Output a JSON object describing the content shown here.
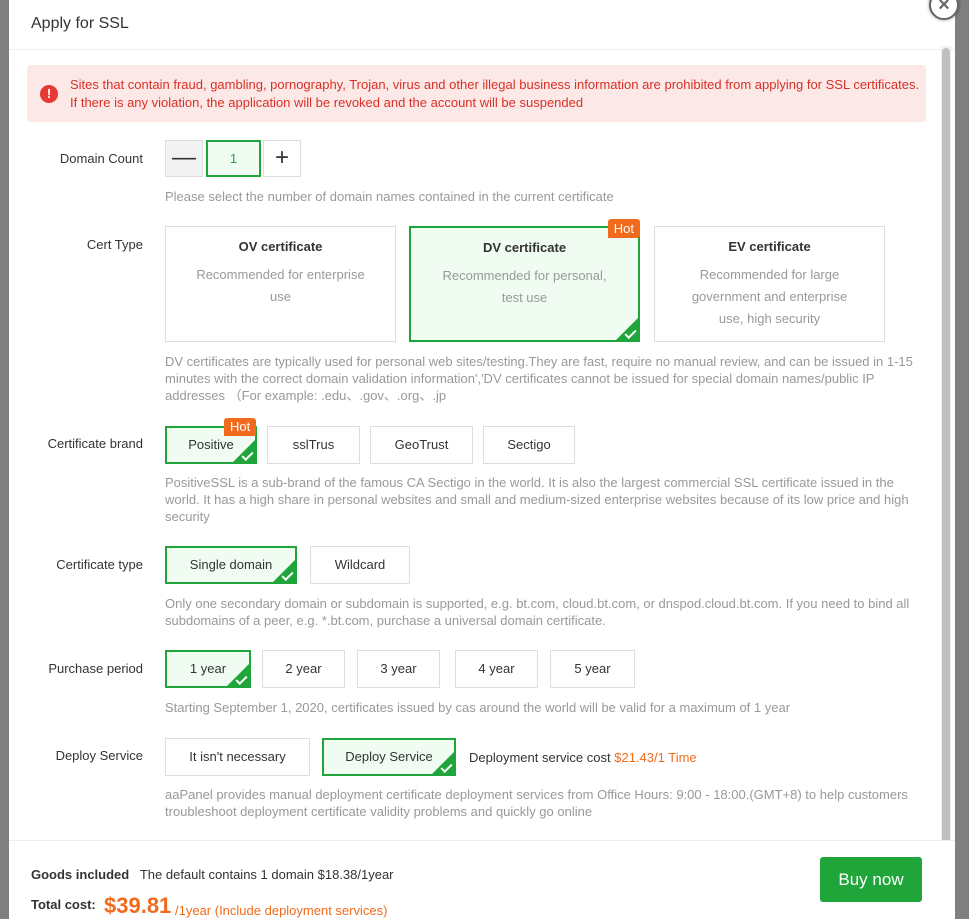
{
  "modal": {
    "title": "Apply for SSL",
    "close_glyph": "×"
  },
  "warning": {
    "icon": "!",
    "text": "Sites that contain fraud, gambling, pornography, Trojan, virus and other illegal business information are prohibited from applying for SSL certificates. If there is any violation, the application will be revoked and the account will be suspended"
  },
  "domain_count": {
    "label": "Domain Count",
    "minus": "—",
    "plus": "+",
    "value": "1",
    "hint": "Please select the number of domain names contained in the current certificate"
  },
  "cert_type": {
    "label": "Cert Type",
    "cards": [
      {
        "title": "OV certificate",
        "desc": "Recommended for enterprise use"
      },
      {
        "title": "DV certificate",
        "desc": "Recommended for personal, test use",
        "badge": "Hot"
      },
      {
        "title": "EV certificate",
        "desc": "Recommended for large government and enterprise use, high security"
      }
    ],
    "selected": "DV certificate",
    "hint": "DV certificates are typically used for personal web sites/testing.They are fast, require no manual review, and can be issued in 1-15 minutes with the correct domain validation information','DV certificates cannot be issued for special domain names/public IP addresses （For example: .edu、.gov、.org、.jp"
  },
  "brand": {
    "label": "Certificate brand",
    "options": [
      "Positive",
      "sslTrus",
      "GeoTrust",
      "Sectigo"
    ],
    "badge": "Hot",
    "selected": "Positive",
    "hint": "PositiveSSL is a sub-brand of the famous CA Sectigo in the world. It is also the largest commercial SSL certificate issued in the world. It has a high share in personal websites and small and medium-sized enterprise websites because of its low price and high security"
  },
  "cert_kind": {
    "label": "Certificate type",
    "options": [
      "Single domain",
      "Wildcard"
    ],
    "selected": "Single domain",
    "hint": "Only one secondary domain or subdomain is supported, e.g. bt.com, cloud.bt.com, or dnspod.cloud.bt.com. If you need to bind all subdomains of a peer, e.g. *.bt.com, purchase a universal domain certificate."
  },
  "period": {
    "label": "Purchase period",
    "options": [
      "1 year",
      "2 year",
      "3 year",
      "4 year",
      "5 year"
    ],
    "selected": "1 year",
    "hint": "Starting September 1, 2020, certificates issued by cas around the world will be valid for a maximum of 1 year"
  },
  "deploy": {
    "label": "Deploy Service",
    "options": [
      "It isn't necessary",
      "Deploy Service"
    ],
    "selected": "Deploy Service",
    "cost_label": "Deployment service cost",
    "cost_value": "$21.43/1 Time",
    "hint": "aaPanel provides manual deployment certificate deployment services from Office Hours: 9:00 - 18:00.(GMT+8) to help customers troubleshoot deployment certificate validity problems and quickly go online"
  },
  "footer": {
    "goods_label": "Goods included",
    "goods_text": "The default contains 1 domain $18.38/1year",
    "total_label": "Total cost:",
    "total_price": "$39.81",
    "total_unit": "/1year (Include deployment services)",
    "buy_label": "Buy now"
  },
  "colors": {
    "accent": "#20a53a",
    "hot": "#f26b1d",
    "warning_text": "#d93025",
    "warning_bg": "#fde8e8"
  }
}
